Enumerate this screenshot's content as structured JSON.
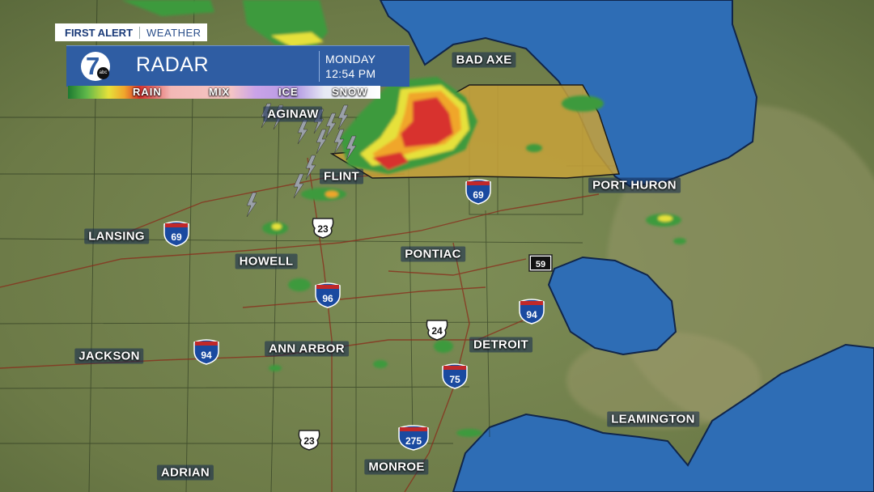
{
  "header": {
    "tag_first": "FIRST ALERT",
    "tag_second": "WEATHER",
    "title": "RADAR",
    "logo_text": "7",
    "logo_small": "abc",
    "day": "MONDAY",
    "time": "12:54 PM"
  },
  "legend": [
    "RAIN",
    "MIX",
    "ICE",
    "SNOW"
  ],
  "cities": [
    "BAD AXE",
    "AGINAW",
    "FLINT",
    "PORT HURON",
    "LANSING",
    "HOWELL",
    "PONTIAC",
    "JACKSON",
    "ANN ARBOR",
    "DETROIT",
    "LEAMINGTON",
    "ADRIAN",
    "MONROE"
  ],
  "highway_shields": [
    "69",
    "69",
    "23",
    "96",
    "59",
    "94",
    "24",
    "94",
    "75",
    "275",
    "23"
  ],
  "colors": {
    "land": "#7a8a55",
    "water": "#2e6db5",
    "warning_box": "#c8a23a",
    "banner_blue": "#2f5da3",
    "radar_heavy": "#d8322e",
    "radar_moderate": "#e6a62c",
    "radar_light": "#3e9a3c"
  },
  "icons": [
    "lightning-icon",
    "interstate-shield-icon",
    "us-route-shield-icon",
    "state-route-shield-icon"
  ]
}
